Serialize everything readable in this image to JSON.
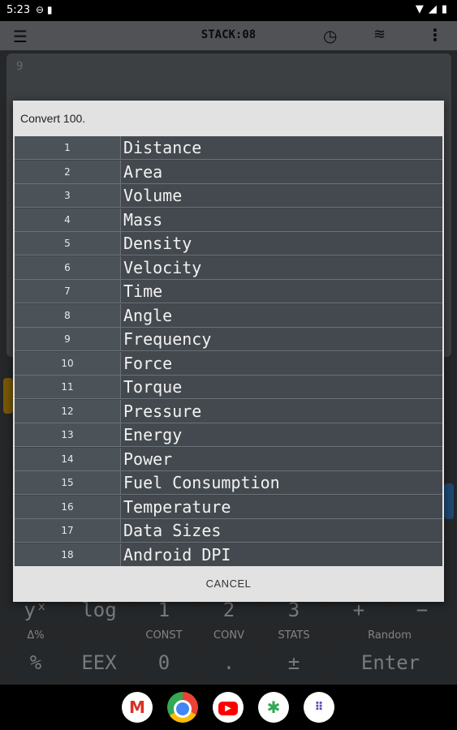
{
  "status_bar": {
    "time": "5:23"
  },
  "app_bar": {
    "stack_label": "STACK:08"
  },
  "display": {
    "line_number": "9"
  },
  "keypad": {
    "row_top": [
      "yˣ",
      "log",
      "1",
      "2",
      "3",
      "+",
      "−"
    ],
    "sublabels": [
      "Δ%",
      "CONST",
      "CONV",
      "STATS",
      "Random"
    ],
    "row_bottom": [
      "%",
      "EEX",
      "0",
      ".",
      "±",
      "Enter"
    ]
  },
  "dialog": {
    "title": "Convert 100.",
    "items": [
      {
        "num": "1",
        "label": "Distance"
      },
      {
        "num": "2",
        "label": "Area"
      },
      {
        "num": "3",
        "label": "Volume"
      },
      {
        "num": "4",
        "label": "Mass"
      },
      {
        "num": "5",
        "label": "Density"
      },
      {
        "num": "6",
        "label": "Velocity"
      },
      {
        "num": "7",
        "label": "Time"
      },
      {
        "num": "8",
        "label": "Angle"
      },
      {
        "num": "9",
        "label": "Frequency"
      },
      {
        "num": "10",
        "label": "Force"
      },
      {
        "num": "11",
        "label": "Torque"
      },
      {
        "num": "12",
        "label": "Pressure"
      },
      {
        "num": "13",
        "label": "Energy"
      },
      {
        "num": "14",
        "label": "Power"
      },
      {
        "num": "15",
        "label": "Fuel Consumption"
      },
      {
        "num": "16",
        "label": "Temperature"
      },
      {
        "num": "17",
        "label": "Data Sizes"
      },
      {
        "num": "18",
        "label": "Android DPI"
      }
    ],
    "cancel_label": "CANCEL"
  },
  "dock_apps": [
    "gmail-icon",
    "chrome-icon",
    "youtube-icon",
    "photos-icon",
    "app-drawer-icon"
  ]
}
